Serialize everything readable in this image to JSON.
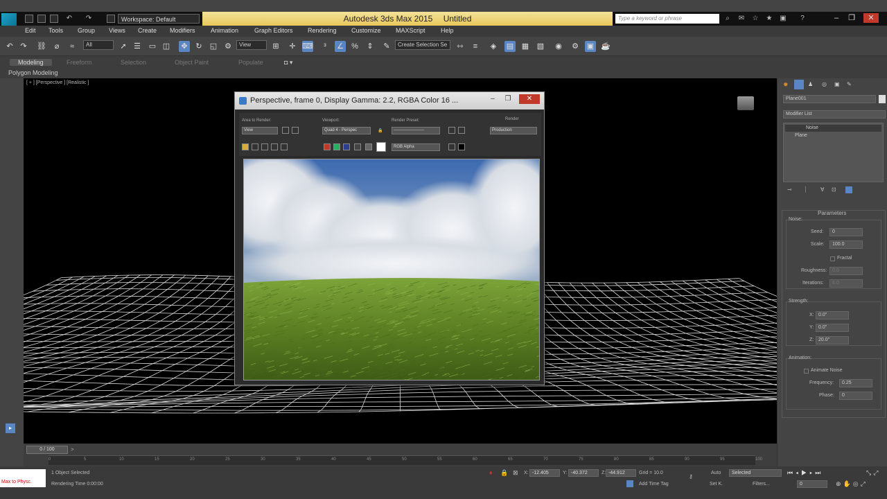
{
  "app": {
    "title": "Autodesk 3ds Max  2015",
    "document": "Untitled",
    "workspace": "Workspace: Default",
    "search_placeholder": "Type a keyword or phrase"
  },
  "menu": [
    "Edit",
    "Tools",
    "Group",
    "Views",
    "Create",
    "Modifiers",
    "Animation",
    "Graph Editors",
    "Rendering",
    "Customize",
    "MAXScript",
    "Help"
  ],
  "toolbar": {
    "selection_filter": "All",
    "ref_coord": "View",
    "named_selection": "Create Selection Se"
  },
  "ribbon": {
    "tabs": [
      "Modeling",
      "Freeform",
      "Selection",
      "Object Paint",
      "Populate"
    ],
    "active_tab": "Modeling",
    "subpanel": "Polygon Modeling"
  },
  "viewport": {
    "label": "[ + ] [Perspective ] [Realistic ]"
  },
  "render_window": {
    "title": "Perspective, frame 0, Display Gamma: 2.2, RGBA Color 16 ...",
    "area_label": "Area to Render:",
    "area_value": "View",
    "viewport_label": "Viewport:",
    "viewport_value": "Quad 4 - Perspec",
    "preset_label": "Render Preset:",
    "preset_value": "----------------------",
    "render_label": "Render",
    "render_value": "Production",
    "channel_value": "RGB Alpha"
  },
  "command_panel": {
    "object_name": "Plane001",
    "modifier_list": "Modifier List",
    "stack": [
      "Noise",
      "Plane"
    ],
    "rollout_title": "Parameters",
    "noise_section": "Noise:",
    "seed_label": "Seed:",
    "seed_value": "0",
    "scale_label": "Scale:",
    "scale_value": "100.0",
    "fractal_label": "Fractal",
    "roughness_label": "Roughness:",
    "roughness_value": "0.0",
    "iterations_label": "Iterations:",
    "iterations_value": "6.0",
    "strength_section": "Strength:",
    "x_label": "X:",
    "x_value": "0.0\"",
    "y_label": "Y:",
    "y_value": "0.0\"",
    "z_label": "Z:",
    "z_value": "20.0\"",
    "animation_section": "Animation:",
    "animate_noise_label": "Animate Noise",
    "frequency_label": "Frequency:",
    "frequency_value": "0.25",
    "phase_label": "Phase:",
    "phase_value": "0"
  },
  "timeline": {
    "frame_slider": "0 / 100",
    "ticks": [
      "0",
      "5",
      "10",
      "15",
      "20",
      "25",
      "30",
      "35",
      "40",
      "45",
      "50",
      "55",
      "60",
      "65",
      "70",
      "75",
      "80",
      "85",
      "90",
      "95",
      "100"
    ]
  },
  "status": {
    "maxscript_label": "Max to Physc.",
    "selection": "1 Object Selected",
    "prompt": "Rendering Time  0:00:00",
    "x_label": "X:",
    "x_value": "-12.405",
    "y_label": "Y:",
    "y_value": "-40.372",
    "z_label": "Z:",
    "z_value": "-44.912",
    "grid": "Grid = 10.0",
    "add_time_tag": "Add Time Tag",
    "autokey_label": "Auto",
    "setkey_label": "Set K.",
    "key_mode": "Selected",
    "filters": "Filters...",
    "current_frame": "0"
  }
}
